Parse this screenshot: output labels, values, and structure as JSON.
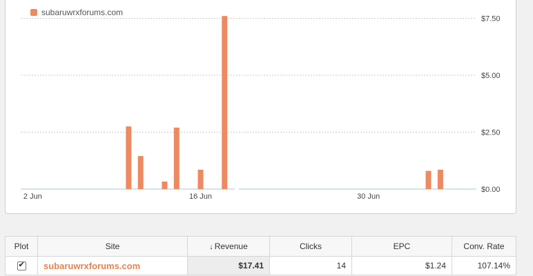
{
  "legend": {
    "label": "subaruwrxforums.com",
    "color": "#ec8a62"
  },
  "chart_data": {
    "type": "bar",
    "series": [
      {
        "name": "subaruwrxforums.com",
        "points": [
          {
            "date": "2024-06-10",
            "value": 2.75
          },
          {
            "date": "2024-06-11",
            "value": 1.45
          },
          {
            "date": "2024-06-13",
            "value": 0.33
          },
          {
            "date": "2024-06-14",
            "value": 2.7
          },
          {
            "date": "2024-06-16",
            "value": 0.85
          },
          {
            "date": "2024-06-18",
            "value": 7.6
          },
          {
            "date": "2024-07-05",
            "value": 0.8
          },
          {
            "date": "2024-07-06",
            "value": 0.85
          }
        ]
      }
    ],
    "x_range": [
      "2024-06-01",
      "2024-07-09"
    ],
    "x_ticks": [
      {
        "date": "2024-06-02",
        "label": "2 Jun"
      },
      {
        "date": "2024-06-16",
        "label": "16 Jun"
      },
      {
        "date": "2024-06-30",
        "label": "30 Jun"
      }
    ],
    "y_ticks": [
      {
        "value": 0,
        "label": "$0.00"
      },
      {
        "value": 2.5,
        "label": "$2.50"
      },
      {
        "value": 5,
        "label": "$5.00"
      },
      {
        "value": 7.5,
        "label": "$7.50"
      }
    ],
    "ylim": [
      0,
      8
    ],
    "grid": true,
    "legend_position": "top-left"
  },
  "table": {
    "headers": {
      "plot": "Plot",
      "site": "Site",
      "revenue": "Revenue",
      "revenue_sort_icon": "↓",
      "clicks": "Clicks",
      "epc": "EPC",
      "conv_rate": "Conv. Rate"
    },
    "rows": [
      {
        "site": "subaruwrxforums.com",
        "revenue": "$17.41",
        "clicks": "14",
        "epc": "$1.24",
        "conv_rate": "107.14%",
        "plotted": true
      }
    ]
  }
}
